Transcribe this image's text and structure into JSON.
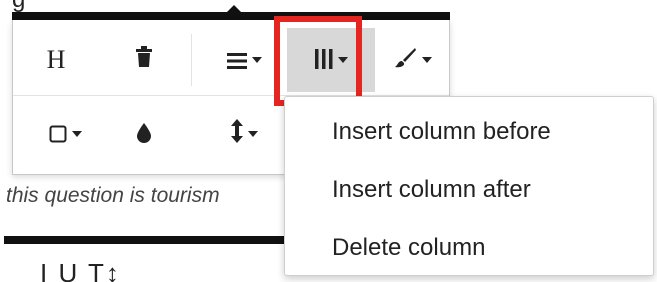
{
  "background": {
    "top_text_fragment": "g",
    "question_fragment": "this question is tourism",
    "bottom_fragment": "I   U   T↕"
  },
  "toolbar": {
    "row1": [
      {
        "name": "heading-button",
        "icon": "H",
        "has_caret": false
      },
      {
        "name": "trash-button",
        "icon": "🗑",
        "has_caret": false
      },
      {
        "name": "align-button",
        "icon": "≡",
        "has_caret": true
      },
      {
        "name": "column-button",
        "icon": "⫼",
        "has_caret": true,
        "active": true
      },
      {
        "name": "brush-button",
        "icon": "🖌",
        "has_caret": true
      }
    ],
    "row2": [
      {
        "name": "border-button",
        "icon": "☐",
        "has_caret": true
      },
      {
        "name": "fill-color-button",
        "icon": "💧",
        "has_caret": false
      },
      {
        "name": "height-button",
        "icon": "↕",
        "has_caret": true
      }
    ]
  },
  "column_menu": {
    "items": [
      "Insert column before",
      "Insert column after",
      "Delete column"
    ]
  },
  "colors": {
    "highlight": "#e52620",
    "active_bg": "#d8d8d8"
  }
}
